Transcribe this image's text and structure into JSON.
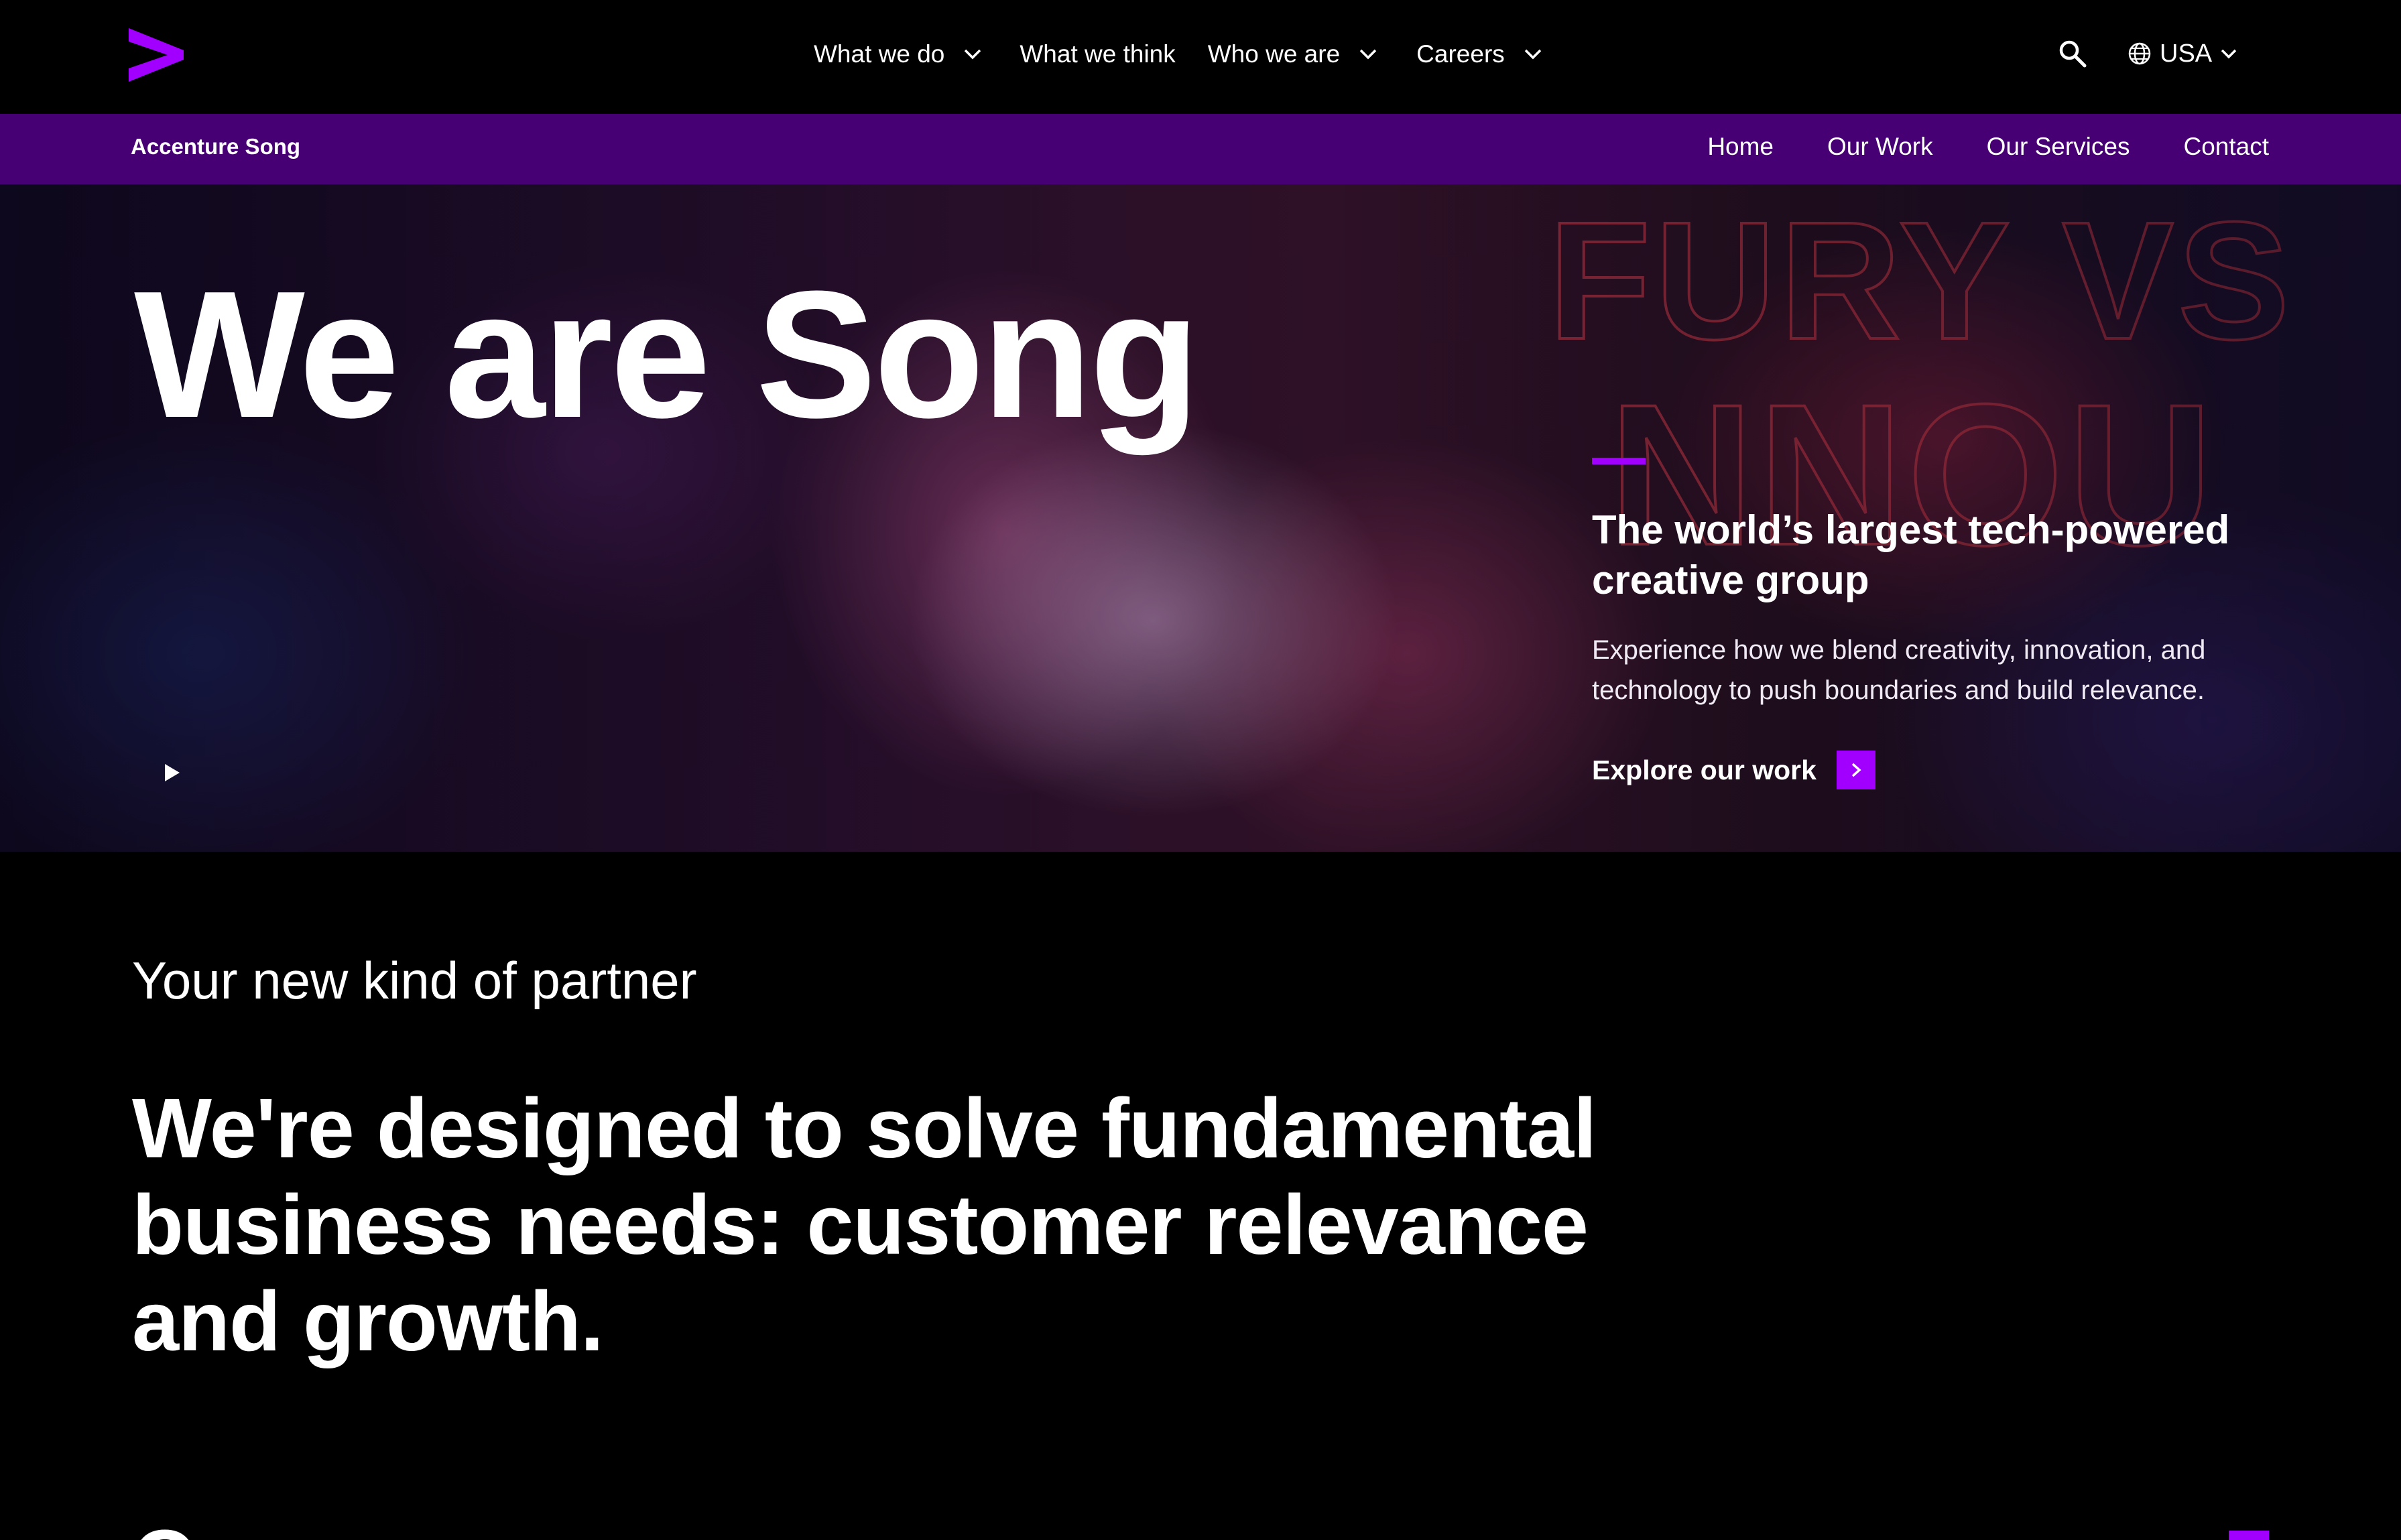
{
  "nav": {
    "items": [
      {
        "label": "What we do",
        "has_dropdown": true
      },
      {
        "label": "What we think",
        "has_dropdown": false
      },
      {
        "label": "Who we are",
        "has_dropdown": true
      },
      {
        "label": "Careers",
        "has_dropdown": true
      }
    ],
    "locale": "USA",
    "icons": {
      "logo": "accenture-chevron-logo",
      "search": "search-icon",
      "globe": "globe-icon"
    }
  },
  "subnav": {
    "brand": "Accenture Song",
    "links": [
      "Home",
      "Our Work",
      "Our Services",
      "Contact"
    ]
  },
  "hero": {
    "title": "We are Song",
    "tagline": "The world’s largest tech-powered creative group",
    "description": "Experience how we blend creativity, innovation, and technology to push boundaries and build relevance.",
    "cta_label": "Explore our work",
    "play_icon": "play-icon"
  },
  "section": {
    "eyebrow": "Your new kind of partner",
    "statement": "We're designed to solve fundamental business needs: customer relevance and growth."
  },
  "colors": {
    "accent": "#a100ff",
    "subnav_bg": "#460073",
    "background": "#000000",
    "text": "#ffffff"
  }
}
